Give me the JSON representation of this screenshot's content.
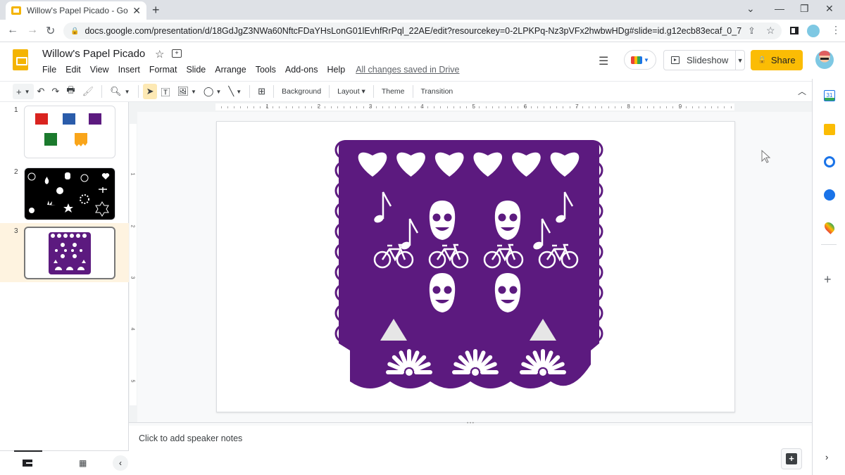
{
  "browser": {
    "tab_title": "Willow's Papel Picado - Google S",
    "url": "docs.google.com/presentation/d/18GdJgZ3NWa60NftcFDaYHsLonG01lEvhfRrPql_22AE/edit?resourcekey=0-2LPKPq-Nz3pVFx2hwbwHDg#slide=id.g12ecb83ecaf_0_7"
  },
  "app": {
    "doc_title": "Willow's Papel Picado",
    "menu": [
      "File",
      "Edit",
      "View",
      "Insert",
      "Format",
      "Slide",
      "Arrange",
      "Tools",
      "Add-ons",
      "Help"
    ],
    "save_status": "All changes saved in Drive",
    "slideshow_label": "Slideshow",
    "share_label": "Share"
  },
  "toolbar": {
    "background_label": "Background",
    "layout_label": "Layout",
    "theme_label": "Theme",
    "transition_label": "Transition"
  },
  "filmstrip": {
    "slides": [
      {
        "number": "1",
        "description": "five colored papel picado shapes"
      },
      {
        "number": "2",
        "description": "white icons on black background"
      },
      {
        "number": "3",
        "description": "purple papel picado design",
        "active": true
      }
    ]
  },
  "ruler": {
    "horizontal_labels": [
      "1",
      "2",
      "3",
      "4",
      "5",
      "6",
      "7",
      "8",
      "9"
    ],
    "vertical_labels": [
      "1",
      "2",
      "3",
      "4",
      "5"
    ]
  },
  "slide": {
    "banner_color": "#5c1a7f",
    "cutout_color": "#ffffff",
    "triangle_color": "#e6e6e6",
    "hearts": 6,
    "skulls": 4,
    "bicycles": 4,
    "music_notes": 4,
    "triangles": 2,
    "fans": 3
  },
  "notes": {
    "placeholder": "Click to add speaker notes"
  },
  "colors": {
    "share_bg": "#fbbc04",
    "active_slide_bg": "#fef3e0",
    "selected_tool_bg": "#fde9b4"
  }
}
